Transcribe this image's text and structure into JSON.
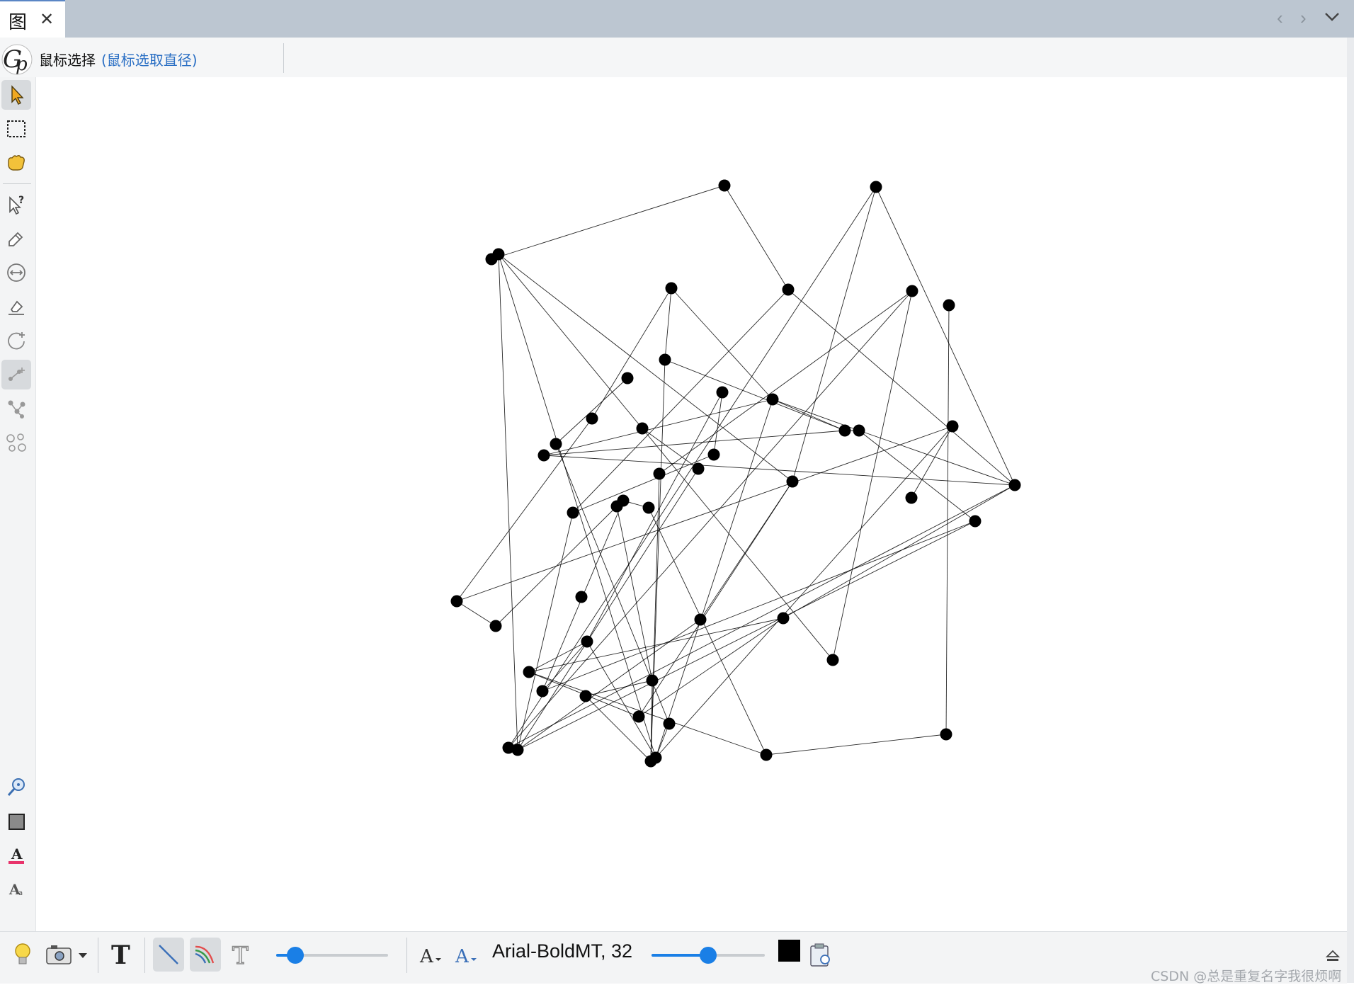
{
  "tab": {
    "title": "图",
    "close": "✕"
  },
  "nav": {
    "prev": "‹",
    "next": "›"
  },
  "mode": {
    "label": "鼠标选择",
    "hint": "(鼠标选取直径)"
  },
  "font_label": "Arial-BoldMT, 32",
  "color": {
    "swatch": "#000000",
    "accent": "#1a7fe6",
    "hint": "#2a6fc4"
  },
  "watermark": "CSDN @总是重复名字我很烦啊",
  "icons": {
    "left_toolbar": [
      "pointer-icon",
      "rectangle-select-icon",
      "hand-icon",
      "query-pointer-icon",
      "edit-pencil-icon",
      "resize-arrows-icon",
      "eraser-icon",
      "rotate-icon",
      "add-node-icon",
      "graph-edge-icon",
      "cluster-icon",
      "zoom-icon",
      "fill-square-icon",
      "text-color-icon",
      "text-style-icon"
    ],
    "bottom_toolbar": [
      "lightbulb-icon",
      "camera-icon",
      "dropdown-arrow-icon",
      "text-bold-icon",
      "line-tool-icon",
      "curve-tool-icon",
      "text-outline-icon",
      "font-size-down-icon",
      "font-size-up-icon",
      "copy-clipboard-icon",
      "eject-icon"
    ]
  },
  "sliders": {
    "edge_width": 0.17,
    "font_size": 0.5
  }
}
